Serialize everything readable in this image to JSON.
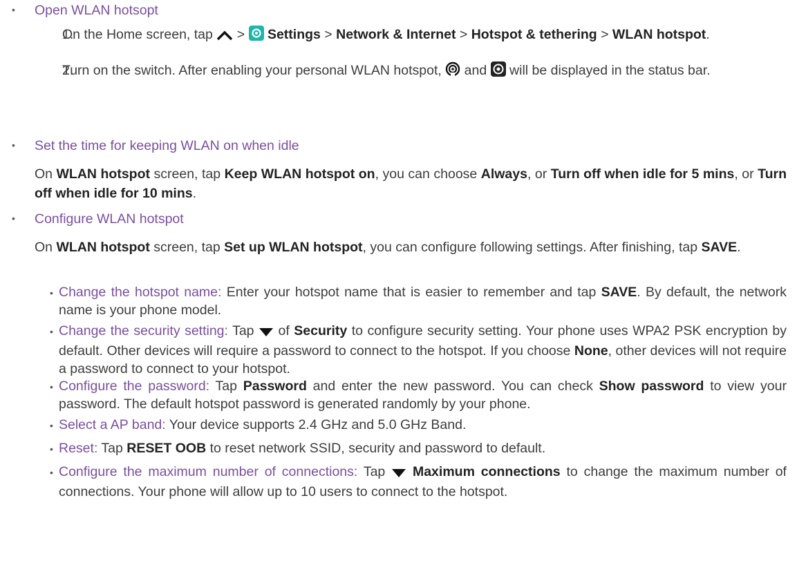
{
  "sections": [
    {
      "heading": "Open WLAN hotsopt",
      "step1": {
        "num": "1.",
        "t1": "On the Home screen, tap ",
        "t2": " > ",
        "settings": "Settings",
        "t3": " > ",
        "network": "Network & Internet",
        "t4": " > ",
        "hotspot_tethering": "Hotspot & tethering",
        "t5": " > ",
        "wlan_hotspot": "WLAN hotspot",
        "t6": "."
      },
      "step2": {
        "num": "2.",
        "t1": "Turn on the switch. After enabling your personal WLAN hotspot, ",
        "t2": " and ",
        "t3": " will be displayed in the status bar."
      }
    },
    {
      "heading": "Set the time for keeping WLAN on when idle",
      "p": {
        "t1": "On ",
        "b1": "WLAN hotspot",
        "t2": " screen, tap ",
        "b2": "Keep WLAN hotspot on",
        "t3": ", you can choose ",
        "b3": "Always",
        "t4": ", or ",
        "b4": "Turn off when idle for 5 mins",
        "t5": ", or ",
        "b5": "Turn off when idle for 10 mins",
        "t6": "."
      }
    },
    {
      "heading": "Configure WLAN hotspot",
      "p": {
        "t1": "On ",
        "b1": "WLAN hotspot",
        "t2": " screen, tap ",
        "b2": "Set up WLAN hotspot",
        "t3": ", you can configure following settings. After finishing, tap ",
        "b3": "SAVE",
        "t4": "."
      },
      "items": {
        "name": {
          "label": "Change the hotspot name:",
          "t1": " Enter your hotspot name that is easier to remember and tap ",
          "b1": "SAVE",
          "t2": ". By default, the network name is your phone model."
        },
        "security": {
          "label": "Change the security setting:",
          "t1": " Tap ",
          "t2": " of ",
          "b1": "Security",
          "t3": " to configure security setting. Your phone uses WPA2 PSK encryption by default. Other devices will require a password to connect to the hotspot. If you choose ",
          "b2": "None",
          "t4": ", other devices will not require a password to connect to your hotspot."
        },
        "password": {
          "label": "Configure the password:",
          "t1": " Tap ",
          "b1": "Password",
          "t2": " and enter the new password. You can check ",
          "b2": "Show password",
          "t3": " to view your password. The default hotspot password is generated randomly by your phone."
        },
        "band": {
          "label": "Select a AP band:",
          "t1": " Your device supports 2.4 GHz and 5.0 GHz Band."
        },
        "reset": {
          "label": "Reset:",
          "t1": " Tap ",
          "b1": "RESET OOB",
          "t2": " to reset network SSID, security and password to default."
        },
        "maxconn": {
          "label": "Configure the maximum number of connections:",
          "t1": " Tap ",
          "b1": "Maximum connections",
          "t2": " to change the maximum number of connections. Your phone will allow up to 10 users to connect to the hotspot."
        }
      }
    }
  ],
  "bullet_glyph": "•",
  "colors": {
    "heading": "#7a4fa0",
    "settings_icon_bg": "#1fb5a8",
    "text": "#3c3c3c"
  },
  "icons": [
    "chevron-up-icon",
    "settings-icon",
    "hotspot-icon",
    "target-icon",
    "triangle-down-icon"
  ]
}
